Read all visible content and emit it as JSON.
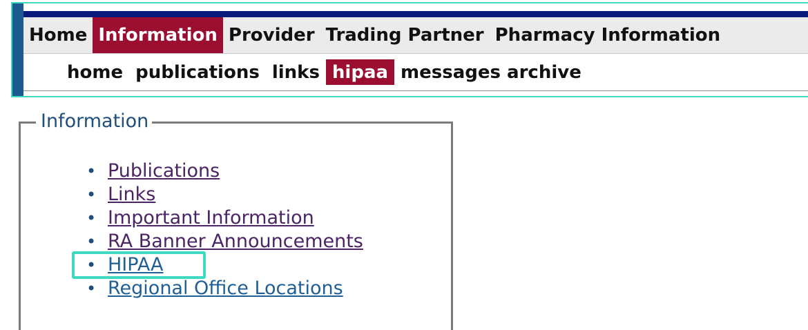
{
  "nav": {
    "main": [
      {
        "label": "Home",
        "active": false
      },
      {
        "label": "Information",
        "active": true
      },
      {
        "label": "Provider",
        "active": false
      },
      {
        "label": "Trading Partner",
        "active": false
      },
      {
        "label": "Pharmacy Information",
        "active": false
      }
    ],
    "sub": [
      {
        "label": "home",
        "active": false
      },
      {
        "label": "publications",
        "active": false
      },
      {
        "label": "links",
        "active": false
      },
      {
        "label": "hipaa",
        "active": true
      },
      {
        "label": "messages archive",
        "active": false
      }
    ]
  },
  "info": {
    "legend": "Information",
    "items": [
      {
        "label": "Publications"
      },
      {
        "label": "Links"
      },
      {
        "label": "Important Information"
      },
      {
        "label": "RA Banner Announcements"
      },
      {
        "label": "HIPAA"
      },
      {
        "label": "Regional Office Locations"
      }
    ],
    "bullet": "•"
  },
  "colors": {
    "active_tab": "#9b0e2f",
    "nav_top_bar": "#0a1a7a",
    "nav_left_bar": "#1e5a8e",
    "highlight": "#3fd8c0",
    "link_visited": "#4b2466",
    "link_unvisited": "#1f5f96",
    "legend_text": "#1f4f7e"
  }
}
